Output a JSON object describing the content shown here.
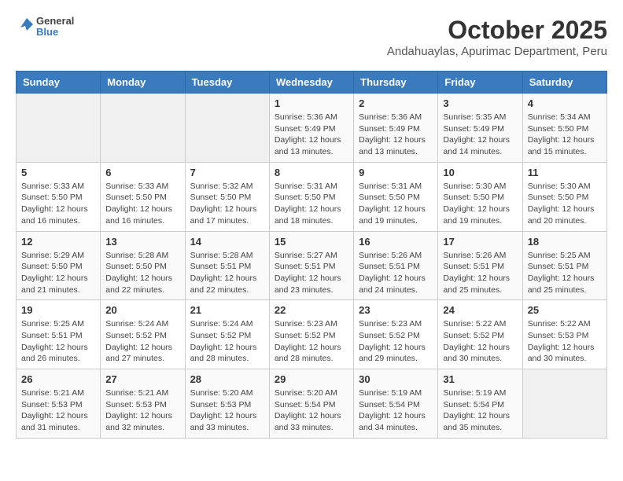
{
  "logo": {
    "general": "General",
    "blue": "Blue"
  },
  "title": "October 2025",
  "subtitle": "Andahuaylas, Apurimac Department, Peru",
  "weekdays": [
    "Sunday",
    "Monday",
    "Tuesday",
    "Wednesday",
    "Thursday",
    "Friday",
    "Saturday"
  ],
  "weeks": [
    [
      {
        "day": "",
        "info": ""
      },
      {
        "day": "",
        "info": ""
      },
      {
        "day": "",
        "info": ""
      },
      {
        "day": "1",
        "info": "Sunrise: 5:36 AM\nSunset: 5:49 PM\nDaylight: 12 hours\nand 13 minutes."
      },
      {
        "day": "2",
        "info": "Sunrise: 5:36 AM\nSunset: 5:49 PM\nDaylight: 12 hours\nand 13 minutes."
      },
      {
        "day": "3",
        "info": "Sunrise: 5:35 AM\nSunset: 5:49 PM\nDaylight: 12 hours\nand 14 minutes."
      },
      {
        "day": "4",
        "info": "Sunrise: 5:34 AM\nSunset: 5:50 PM\nDaylight: 12 hours\nand 15 minutes."
      }
    ],
    [
      {
        "day": "5",
        "info": "Sunrise: 5:33 AM\nSunset: 5:50 PM\nDaylight: 12 hours\nand 16 minutes."
      },
      {
        "day": "6",
        "info": "Sunrise: 5:33 AM\nSunset: 5:50 PM\nDaylight: 12 hours\nand 16 minutes."
      },
      {
        "day": "7",
        "info": "Sunrise: 5:32 AM\nSunset: 5:50 PM\nDaylight: 12 hours\nand 17 minutes."
      },
      {
        "day": "8",
        "info": "Sunrise: 5:31 AM\nSunset: 5:50 PM\nDaylight: 12 hours\nand 18 minutes."
      },
      {
        "day": "9",
        "info": "Sunrise: 5:31 AM\nSunset: 5:50 PM\nDaylight: 12 hours\nand 19 minutes."
      },
      {
        "day": "10",
        "info": "Sunrise: 5:30 AM\nSunset: 5:50 PM\nDaylight: 12 hours\nand 19 minutes."
      },
      {
        "day": "11",
        "info": "Sunrise: 5:30 AM\nSunset: 5:50 PM\nDaylight: 12 hours\nand 20 minutes."
      }
    ],
    [
      {
        "day": "12",
        "info": "Sunrise: 5:29 AM\nSunset: 5:50 PM\nDaylight: 12 hours\nand 21 minutes."
      },
      {
        "day": "13",
        "info": "Sunrise: 5:28 AM\nSunset: 5:50 PM\nDaylight: 12 hours\nand 22 minutes."
      },
      {
        "day": "14",
        "info": "Sunrise: 5:28 AM\nSunset: 5:51 PM\nDaylight: 12 hours\nand 22 minutes."
      },
      {
        "day": "15",
        "info": "Sunrise: 5:27 AM\nSunset: 5:51 PM\nDaylight: 12 hours\nand 23 minutes."
      },
      {
        "day": "16",
        "info": "Sunrise: 5:26 AM\nSunset: 5:51 PM\nDaylight: 12 hours\nand 24 minutes."
      },
      {
        "day": "17",
        "info": "Sunrise: 5:26 AM\nSunset: 5:51 PM\nDaylight: 12 hours\nand 25 minutes."
      },
      {
        "day": "18",
        "info": "Sunrise: 5:25 AM\nSunset: 5:51 PM\nDaylight: 12 hours\nand 25 minutes."
      }
    ],
    [
      {
        "day": "19",
        "info": "Sunrise: 5:25 AM\nSunset: 5:51 PM\nDaylight: 12 hours\nand 26 minutes."
      },
      {
        "day": "20",
        "info": "Sunrise: 5:24 AM\nSunset: 5:52 PM\nDaylight: 12 hours\nand 27 minutes."
      },
      {
        "day": "21",
        "info": "Sunrise: 5:24 AM\nSunset: 5:52 PM\nDaylight: 12 hours\nand 28 minutes."
      },
      {
        "day": "22",
        "info": "Sunrise: 5:23 AM\nSunset: 5:52 PM\nDaylight: 12 hours\nand 28 minutes."
      },
      {
        "day": "23",
        "info": "Sunrise: 5:23 AM\nSunset: 5:52 PM\nDaylight: 12 hours\nand 29 minutes."
      },
      {
        "day": "24",
        "info": "Sunrise: 5:22 AM\nSunset: 5:52 PM\nDaylight: 12 hours\nand 30 minutes."
      },
      {
        "day": "25",
        "info": "Sunrise: 5:22 AM\nSunset: 5:53 PM\nDaylight: 12 hours\nand 30 minutes."
      }
    ],
    [
      {
        "day": "26",
        "info": "Sunrise: 5:21 AM\nSunset: 5:53 PM\nDaylight: 12 hours\nand 31 minutes."
      },
      {
        "day": "27",
        "info": "Sunrise: 5:21 AM\nSunset: 5:53 PM\nDaylight: 12 hours\nand 32 minutes."
      },
      {
        "day": "28",
        "info": "Sunrise: 5:20 AM\nSunset: 5:53 PM\nDaylight: 12 hours\nand 33 minutes."
      },
      {
        "day": "29",
        "info": "Sunrise: 5:20 AM\nSunset: 5:54 PM\nDaylight: 12 hours\nand 33 minutes."
      },
      {
        "day": "30",
        "info": "Sunrise: 5:19 AM\nSunset: 5:54 PM\nDaylight: 12 hours\nand 34 minutes."
      },
      {
        "day": "31",
        "info": "Sunrise: 5:19 AM\nSunset: 5:54 PM\nDaylight: 12 hours\nand 35 minutes."
      },
      {
        "day": "",
        "info": ""
      }
    ]
  ]
}
